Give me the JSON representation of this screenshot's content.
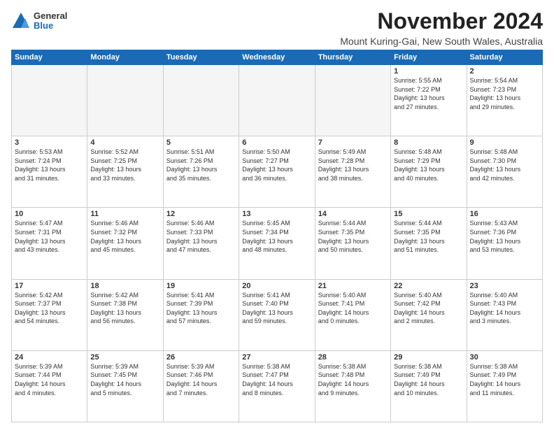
{
  "logo": {
    "general": "General",
    "blue": "Blue"
  },
  "header": {
    "month": "November 2024",
    "location": "Mount Kuring-Gai, New South Wales, Australia"
  },
  "weekdays": [
    "Sunday",
    "Monday",
    "Tuesday",
    "Wednesday",
    "Thursday",
    "Friday",
    "Saturday"
  ],
  "weeks": [
    [
      {
        "day": "",
        "info": ""
      },
      {
        "day": "",
        "info": ""
      },
      {
        "day": "",
        "info": ""
      },
      {
        "day": "",
        "info": ""
      },
      {
        "day": "",
        "info": ""
      },
      {
        "day": "1",
        "info": "Sunrise: 5:55 AM\nSunset: 7:22 PM\nDaylight: 13 hours\nand 27 minutes."
      },
      {
        "day": "2",
        "info": "Sunrise: 5:54 AM\nSunset: 7:23 PM\nDaylight: 13 hours\nand 29 minutes."
      }
    ],
    [
      {
        "day": "3",
        "info": "Sunrise: 5:53 AM\nSunset: 7:24 PM\nDaylight: 13 hours\nand 31 minutes."
      },
      {
        "day": "4",
        "info": "Sunrise: 5:52 AM\nSunset: 7:25 PM\nDaylight: 13 hours\nand 33 minutes."
      },
      {
        "day": "5",
        "info": "Sunrise: 5:51 AM\nSunset: 7:26 PM\nDaylight: 13 hours\nand 35 minutes."
      },
      {
        "day": "6",
        "info": "Sunrise: 5:50 AM\nSunset: 7:27 PM\nDaylight: 13 hours\nand 36 minutes."
      },
      {
        "day": "7",
        "info": "Sunrise: 5:49 AM\nSunset: 7:28 PM\nDaylight: 13 hours\nand 38 minutes."
      },
      {
        "day": "8",
        "info": "Sunrise: 5:48 AM\nSunset: 7:29 PM\nDaylight: 13 hours\nand 40 minutes."
      },
      {
        "day": "9",
        "info": "Sunrise: 5:48 AM\nSunset: 7:30 PM\nDaylight: 13 hours\nand 42 minutes."
      }
    ],
    [
      {
        "day": "10",
        "info": "Sunrise: 5:47 AM\nSunset: 7:31 PM\nDaylight: 13 hours\nand 43 minutes."
      },
      {
        "day": "11",
        "info": "Sunrise: 5:46 AM\nSunset: 7:32 PM\nDaylight: 13 hours\nand 45 minutes."
      },
      {
        "day": "12",
        "info": "Sunrise: 5:46 AM\nSunset: 7:33 PM\nDaylight: 13 hours\nand 47 minutes."
      },
      {
        "day": "13",
        "info": "Sunrise: 5:45 AM\nSunset: 7:34 PM\nDaylight: 13 hours\nand 48 minutes."
      },
      {
        "day": "14",
        "info": "Sunrise: 5:44 AM\nSunset: 7:35 PM\nDaylight: 13 hours\nand 50 minutes."
      },
      {
        "day": "15",
        "info": "Sunrise: 5:44 AM\nSunset: 7:35 PM\nDaylight: 13 hours\nand 51 minutes."
      },
      {
        "day": "16",
        "info": "Sunrise: 5:43 AM\nSunset: 7:36 PM\nDaylight: 13 hours\nand 53 minutes."
      }
    ],
    [
      {
        "day": "17",
        "info": "Sunrise: 5:42 AM\nSunset: 7:37 PM\nDaylight: 13 hours\nand 54 minutes."
      },
      {
        "day": "18",
        "info": "Sunrise: 5:42 AM\nSunset: 7:38 PM\nDaylight: 13 hours\nand 56 minutes."
      },
      {
        "day": "19",
        "info": "Sunrise: 5:41 AM\nSunset: 7:39 PM\nDaylight: 13 hours\nand 57 minutes."
      },
      {
        "day": "20",
        "info": "Sunrise: 5:41 AM\nSunset: 7:40 PM\nDaylight: 13 hours\nand 59 minutes."
      },
      {
        "day": "21",
        "info": "Sunrise: 5:40 AM\nSunset: 7:41 PM\nDaylight: 14 hours\nand 0 minutes."
      },
      {
        "day": "22",
        "info": "Sunrise: 5:40 AM\nSunset: 7:42 PM\nDaylight: 14 hours\nand 2 minutes."
      },
      {
        "day": "23",
        "info": "Sunrise: 5:40 AM\nSunset: 7:43 PM\nDaylight: 14 hours\nand 3 minutes."
      }
    ],
    [
      {
        "day": "24",
        "info": "Sunrise: 5:39 AM\nSunset: 7:44 PM\nDaylight: 14 hours\nand 4 minutes."
      },
      {
        "day": "25",
        "info": "Sunrise: 5:39 AM\nSunset: 7:45 PM\nDaylight: 14 hours\nand 5 minutes."
      },
      {
        "day": "26",
        "info": "Sunrise: 5:39 AM\nSunset: 7:46 PM\nDaylight: 14 hours\nand 7 minutes."
      },
      {
        "day": "27",
        "info": "Sunrise: 5:38 AM\nSunset: 7:47 PM\nDaylight: 14 hours\nand 8 minutes."
      },
      {
        "day": "28",
        "info": "Sunrise: 5:38 AM\nSunset: 7:48 PM\nDaylight: 14 hours\nand 9 minutes."
      },
      {
        "day": "29",
        "info": "Sunrise: 5:38 AM\nSunset: 7:49 PM\nDaylight: 14 hours\nand 10 minutes."
      },
      {
        "day": "30",
        "info": "Sunrise: 5:38 AM\nSunset: 7:49 PM\nDaylight: 14 hours\nand 11 minutes."
      }
    ]
  ]
}
